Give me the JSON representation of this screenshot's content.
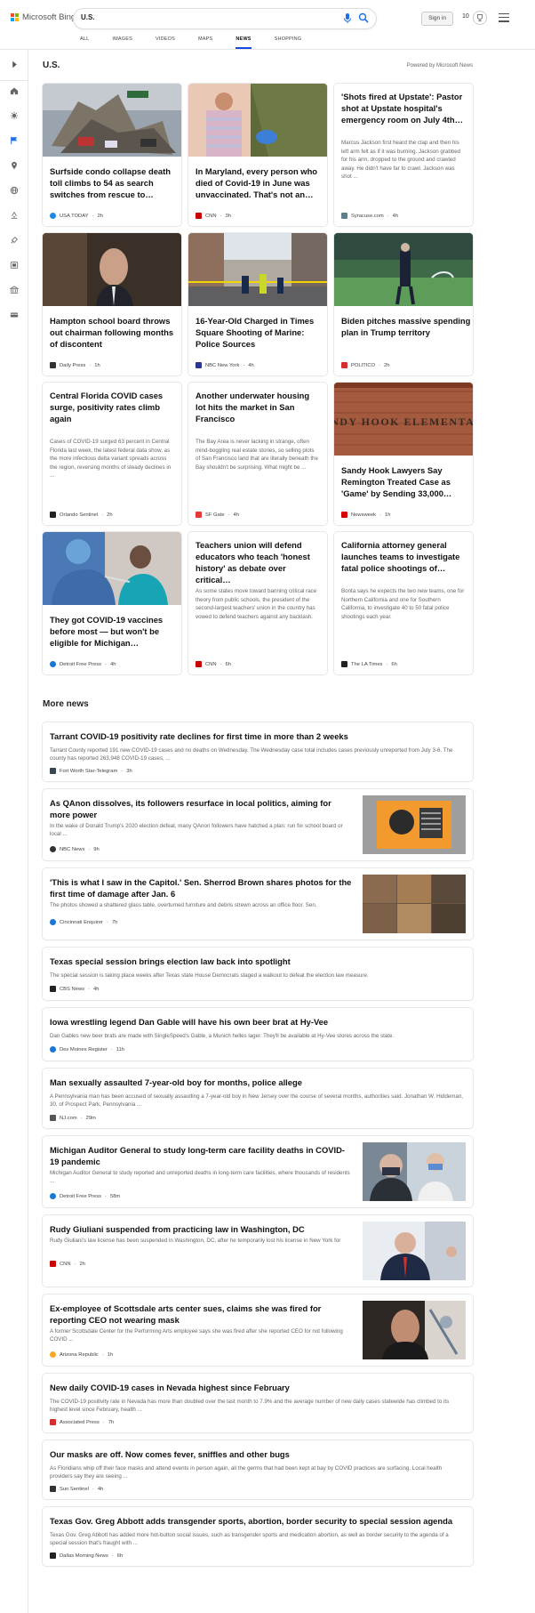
{
  "brand": {
    "name": "Microsoft Bing",
    "colors": [
      "#f25022",
      "#7fba00",
      "#00a4ef",
      "#ffb900"
    ]
  },
  "search": {
    "query": "U.S."
  },
  "header": {
    "signin": "Sign in",
    "rewards": "10"
  },
  "tabs": [
    "ALL",
    "IMAGES",
    "VIDEOS",
    "MAPS",
    "NEWS",
    "SHOPPING"
  ],
  "active_tab": "NEWS",
  "section": {
    "title": "U.S.",
    "powered": "Powered by Microsoft News"
  },
  "cards": [
    {
      "headline": "Surfside condo collapse death toll climbs to 54 as search switches from rescue to…",
      "snippet": "",
      "source": "USA TODAY",
      "time": "2h",
      "fav": "#1e88e5"
    },
    {
      "headline": "In Maryland, every person who died of Covid-19 in June was unvaccinated. That's not an…",
      "snippet": "",
      "source": "CNN",
      "time": "3h",
      "fav": "#cc0000"
    },
    {
      "headline": "'Shots fired at Upstate': Pastor shot at Upstate hospital's emergency room on July 4th…",
      "snippet": "Marcus Jackson first heard the clap and then his left arm felt as if it was burning. Jackson grabbed for his arm, dropped to the ground and crawled away. He didn't have far to crawl. Jackson was shot ...",
      "source": "Syracuse.com",
      "time": "4h",
      "fav": "#607d8b"
    },
    {
      "headline": "Hampton school board throws out chairman following months of discontent",
      "snippet": "",
      "source": "Daily Press",
      "time": "1h",
      "fav": "#333333"
    },
    {
      "headline": "16-Year-Old Charged in Times Square Shooting of Marine: Police Sources",
      "snippet": "",
      "source": "NBC New York",
      "time": "4h",
      "fav": "#283593"
    },
    {
      "headline": "Biden pitches massive spending plan in Trump territory",
      "snippet": "",
      "source": "POLITICO",
      "time": "2h",
      "fav": "#d32f2f"
    },
    {
      "headline": "Central Florida COVID cases surge, positivity rates climb again",
      "snippet": "Cases of COVID-19 surged 63 percent in Central Florida last week, the latest federal data show, as the more infectious delta variant spreads across the region, reversing months of steady declines in ...",
      "source": "Orlando Sentinel",
      "time": "2h",
      "fav": "#222222"
    },
    {
      "headline": "Another underwater housing lot hits the market in San Francisco",
      "snippet": "The Bay Area is never lacking in strange, often mind-boggling real estate stories, so selling plots of San Francisco land that are literally beneath the Bay shouldn't be surprising. What might be ...",
      "source": "SF Gate",
      "time": "4h",
      "fav": "#e53935"
    },
    {
      "headline": "Sandy Hook Lawyers Say Remington Treated Case as 'Game' by Sending 33,000…",
      "snippet": "",
      "source": "Newsweek",
      "time": "1h",
      "fav": "#d50000"
    },
    {
      "headline": "They got COVID-19 vaccines before most — but won't be eligible for Michigan…",
      "snippet": "",
      "source": "Detroit Free Press",
      "time": "4h",
      "fav": "#1976d2"
    },
    {
      "headline": "Teachers union will defend educators who teach 'honest history' as debate over critical…",
      "snippet": "As some states move toward banning critical race theory from public schools, the president of the second-largest teachers' union in the country has vowed to defend teachers against any backlash.",
      "source": "CNN",
      "time": "6h",
      "fav": "#cc0000"
    },
    {
      "headline": "California attorney general launches teams to investigate fatal police shootings of…",
      "snippet": "Bonta says he expects the two new teams, one for Northern California and one for Southern California, to investigate 40 to 50 fatal police shootings each year.",
      "source": "The LA Times",
      "time": "6h",
      "fav": "#222222"
    }
  ],
  "more_news": {
    "title": "More news",
    "items": [
      {
        "headline": "Tarrant COVID-19 positivity rate declines for first time in more than 2 weeks",
        "snippet": "Tarrant County reported 191 new COVID-19 cases and no deaths on Wednesday. The Wednesday case total includes cases previously unreported from July 3-6. The county has reported 263,948 COVID-19 cases, ...",
        "source": "Fort Worth Star-Telegram",
        "time": "3h",
        "fav": "#37474f",
        "thumb": ""
      },
      {
        "headline": "As QAnon dissolves, its followers resurface in local politics, aiming for more power",
        "snippet": "In the wake of Donald Trump's 2020 election defeat, many QAnon followers have hatched a plan: run for school board or local ...",
        "source": "NBC News",
        "time": "9h",
        "fav": "#333333",
        "thumb": "qanon"
      },
      {
        "headline": "'This is what I saw in the Capitol.' Sen. Sherrod Brown shares photos for the first time of damage after Jan. 6",
        "snippet": "The photos showed a shattered glass table, overturned furniture and debris strewn across an office floor. Sen.",
        "source": "Cincinnati Enquirer",
        "time": "7h",
        "fav": "#1976d2",
        "thumb": "capitol"
      },
      {
        "headline": "Texas special session brings election law back into spotlight",
        "snippet": "The special session is taking place weeks after Texas state House Democrats staged a walkout to defeat the election law measure.",
        "source": "CBS News",
        "time": "4h",
        "fav": "#222222",
        "thumb": ""
      },
      {
        "headline": "Iowa wrestling legend Dan Gable will have his own beer brat at Hy-Vee",
        "snippet": "Dan Gables new beer brats are made with SingleSpeed's Gable, a Munich helles lager. They'll be available at Hy-Vee stores across the state.",
        "source": "Des Moines Register",
        "time": "11h",
        "fav": "#1976d2",
        "thumb": ""
      },
      {
        "headline": "Man sexually assaulted 7-year-old boy for months, police allege",
        "snippet": "A Pennsylvania man has been accused of sexually assaulting a 7-year-old boy in New Jersey over the course of several months, authorities said. Jonathan W. Hiddeman, 30, of Prospect Park, Pennsylvania ...",
        "source": "NJ.com",
        "time": "29m",
        "fav": "#555555",
        "thumb": ""
      },
      {
        "headline": "Michigan Auditor General to study long-term care facility deaths in COVID-19 pandemic",
        "snippet": "Michigan Auditor General to study reported and unreported deaths in long-term care facilities, where thousands of residents ...",
        "source": "Detroit Free Press",
        "time": "58m",
        "fav": "#1976d2",
        "thumb": "michigan"
      },
      {
        "headline": "Rudy Giuliani suspended from practicing law in Washington, DC",
        "snippet": "Rudy Giuliani's law license has been suspended in Washington, DC, after he temporarily lost his license in New York for",
        "source": "CNN",
        "time": "2h",
        "fav": "#cc0000",
        "thumb": "giuliani"
      },
      {
        "headline": "Ex-employee of Scottsdale arts center sues, claims she was fired for reporting CEO not wearing mask",
        "snippet": "A former Scottsdale Center for the Performing Arts employee says she was fired after she reported CEO for not following COVID ...",
        "source": "Arizona Republic",
        "time": "1h",
        "fav": "#f9a825",
        "thumb": "scottsdale"
      },
      {
        "headline": "New daily COVID-19 cases in Nevada highest since February",
        "snippet": "The COVID-19 positivity rate in Nevada has more than doubled over the last month to 7.9% and the average number of new daily cases statewide has climbed to its highest level since February, health ...",
        "source": "Associated Press",
        "time": "7h",
        "fav": "#d32f2f",
        "thumb": ""
      },
      {
        "headline": "Our masks are off. Now comes fever, sniffles and other bugs",
        "snippet": "As Floridians whip off their face masks and attend events in person again, all the germs that had been kept at bay by COVID practices are surfacing. Local health providers say they are seeing ...",
        "source": "Sun Sentinel",
        "time": "4h",
        "fav": "#333333",
        "thumb": ""
      },
      {
        "headline": "Texas Gov. Greg Abbott adds transgender sports, abortion, border security to special session agenda",
        "snippet": "Texas Gov. Greg Abbott has added more hot-button social issues, such as transgender sports and medication abortion, as well as border security to the agenda of a special session that's fraught with ...",
        "source": "Dallas Morning News",
        "time": "6h",
        "fav": "#222222",
        "thumb": ""
      }
    ]
  }
}
